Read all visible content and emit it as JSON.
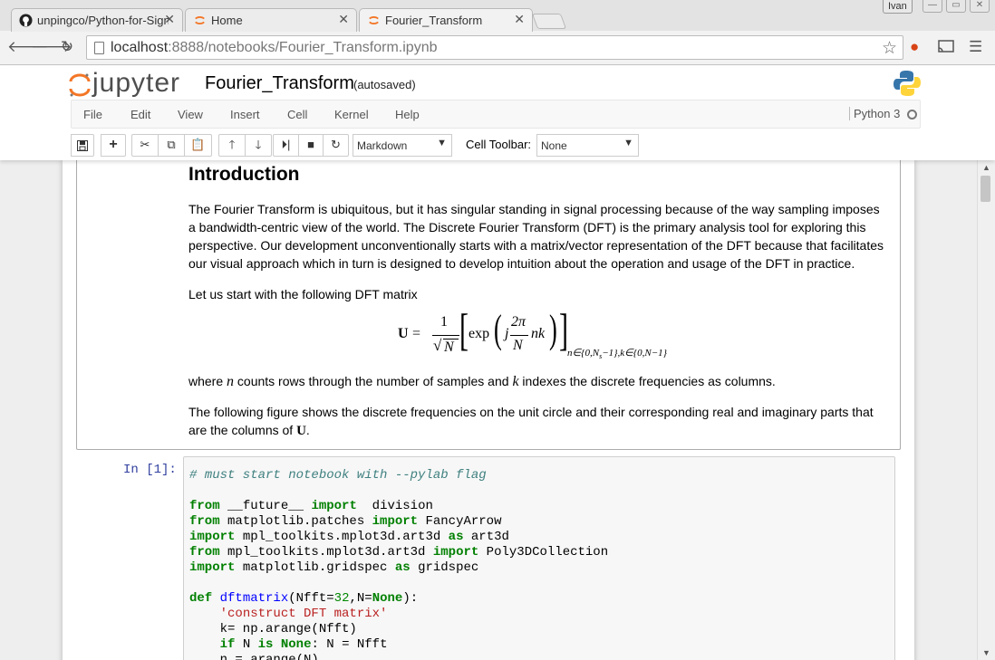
{
  "browser": {
    "tabs": [
      {
        "label": "unpingco/Python-for-Sign",
        "icon": "github-icon"
      },
      {
        "label": "Home",
        "icon": "jupyter-icon"
      },
      {
        "label": "Fourier_Transform",
        "icon": "jupyter-icon"
      }
    ],
    "user": "Ivan",
    "url_host": "localhost",
    "url_path": ":8888/notebooks/Fourier_Transform.ipynb"
  },
  "jupyter": {
    "logo_text": "jupyter",
    "notebook_title": "Fourier_Transform",
    "save_status": "(autosaved)",
    "menu": [
      "File",
      "Edit",
      "View",
      "Insert",
      "Cell",
      "Kernel",
      "Help"
    ],
    "kernel": "Python 3",
    "cell_type": "Markdown",
    "cell_toolbar_label": "Cell Toolbar:",
    "cell_toolbar_value": "None"
  },
  "markdown": {
    "heading": "Introduction",
    "p1": "The Fourier Transform is ubiquitous, but it has singular standing in signal processing because of the way sampling imposes a bandwidth-centric view of the world. The Discrete Fourier Transform (DFT) is the primary analysis tool for exploring this perspective. Our development unconventionally starts with a matrix/vector representation of the DFT because that facilitates our visual approach which in turn is designed to develop intuition about the operation and usage of the DFT in practice.",
    "p2": "Let us start with the following DFT matrix",
    "p3_a": "where ",
    "p3_n": "n",
    "p3_b": " counts rows through the number of samples and ",
    "p3_k": "k",
    "p3_c": " indexes the discrete frequencies as columns.",
    "p4_a": "The following figure shows the discrete frequencies on the unit circle and their corresponding real and imaginary parts that are the columns of ",
    "p4_U": "U",
    "p4_b": "."
  },
  "equation": {
    "lhs": "U",
    "equals": "=",
    "num": "1",
    "den": "N",
    "exp": "exp",
    "j": "j",
    "two_pi": "2π",
    "N": "N",
    "nk": "nk",
    "subscript": "n∈{0,N",
    "subscript2": "s",
    "subscript3": "−1},k∈{0,N−1}"
  },
  "code_cell": {
    "prompt": "In [1]:",
    "lines": [
      "# must start notebook with --pylab flag",
      "",
      "from __future__ import  division",
      "from matplotlib.patches import FancyArrow",
      "import mpl_toolkits.mplot3d.art3d as art3d",
      "from mpl_toolkits.mplot3d.art3d import Poly3DCollection",
      "import matplotlib.gridspec as gridspec",
      "",
      "def dftmatrix(Nfft=32,N=None):",
      "    'construct DFT matrix'",
      "    k= np.arange(Nfft)",
      "    if N is None: N = Nfft",
      "    n = arange(N)"
    ]
  }
}
